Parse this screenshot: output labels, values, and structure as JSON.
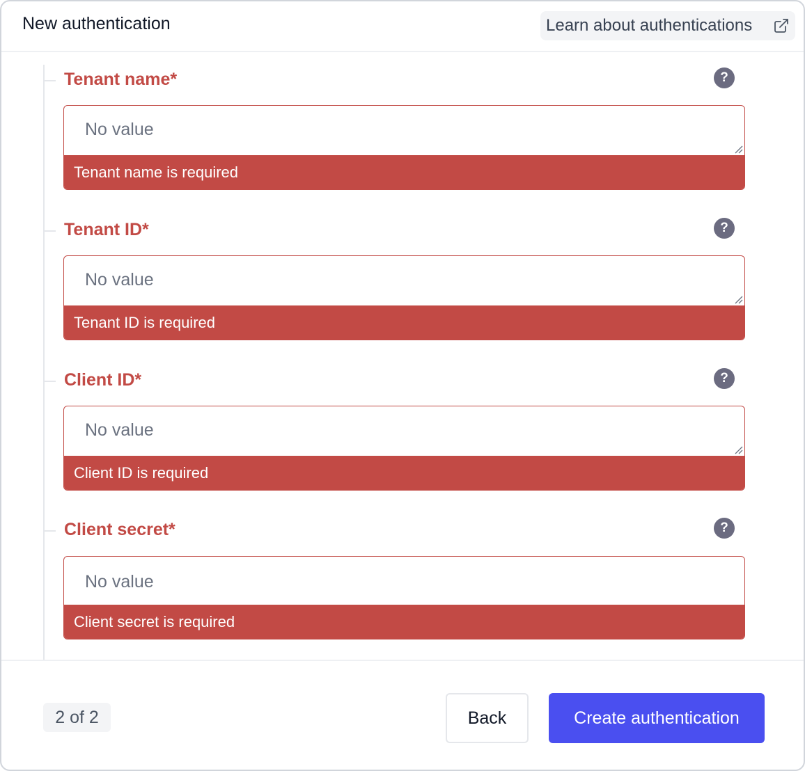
{
  "header": {
    "title": "New authentication",
    "learn_link_label": "Learn about authentications",
    "learn_link_icon": "external-link-icon"
  },
  "fields": [
    {
      "label": "Tenant name*",
      "placeholder": "No value",
      "value": "",
      "error": "Tenant name is required",
      "help_icon": "question-circle-icon"
    },
    {
      "label": "Tenant ID*",
      "placeholder": "No value",
      "value": "",
      "error": "Tenant ID is required",
      "help_icon": "question-circle-icon"
    },
    {
      "label": "Client ID*",
      "placeholder": "No value",
      "value": "",
      "error": "Client ID is required",
      "help_icon": "question-circle-icon"
    },
    {
      "label": "Client secret*",
      "placeholder": "No value",
      "value": "",
      "error": "Client secret is required",
      "help_icon": "question-circle-icon"
    }
  ],
  "help_glyph": "?",
  "footer": {
    "step": "2 of 2",
    "back_label": "Back",
    "create_label": "Create authentication"
  },
  "colors": {
    "error": "#c24a45",
    "primary": "#4a4ff0",
    "help_icon_bg": "#6b6b80"
  }
}
